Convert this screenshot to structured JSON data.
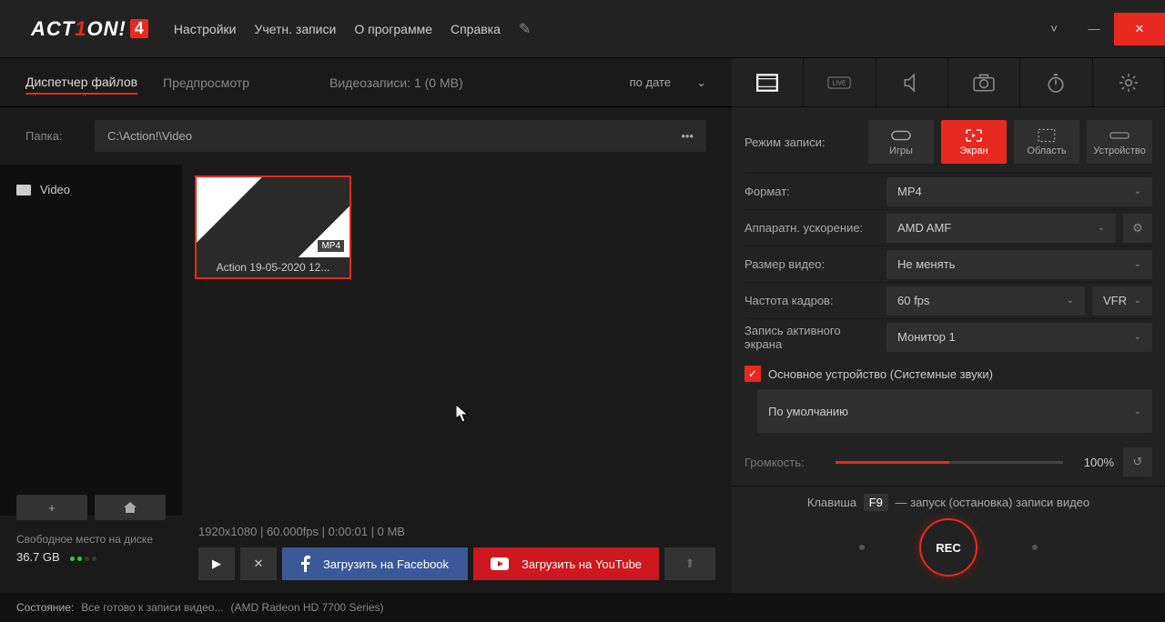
{
  "menu": {
    "settings": "Настройки",
    "accounts": "Учетн. записи",
    "about": "О программе",
    "help": "Справка"
  },
  "lefttabs": {
    "files": "Диспетчер файлов",
    "preview": "Предпросмотр",
    "count": "Видеозаписи: 1 (0 MB)",
    "sort": "по дате"
  },
  "folder": {
    "label": "Папка:",
    "path": "C:\\Action!\\Video"
  },
  "tree": {
    "video": "Video"
  },
  "thumb": {
    "name": "Action 19-05-2020 12...",
    "badge": "MP4"
  },
  "disk": {
    "label": "Свободное место на диске",
    "value": "36.7 GB"
  },
  "fileinfo": "1920x1080 | 60.000fps | 0:00:01 | 0 MB",
  "upload": {
    "fb": "Загрузить на Facebook",
    "yt": "Загрузить на YouTube"
  },
  "modes": {
    "label": "Режим записи:",
    "games": "Игры",
    "screen": "Экран",
    "region": "Область",
    "device": "Устройство"
  },
  "settingsp": {
    "format_l": "Формат:",
    "format_v": "MP4",
    "hw_l": "Аппаратн. ускорение:",
    "hw_v": "AMD AMF",
    "size_l": "Размер видео:",
    "size_v": "Не менять",
    "fps_l": "Частота кадров:",
    "fps_v": "60 fps",
    "fps_mode": "VFR",
    "mon_l": "Запись активного экрана",
    "mon_v": "Монитор 1",
    "audio_l": "Основное устройство (Системные звуки)",
    "audio_v": "По умолчанию",
    "vol_l": "Громкость:",
    "vol_v": "100%"
  },
  "rec": {
    "hint_pre": "Клавиша",
    "key": "F9",
    "hint_post": "— запуск (остановка) записи видео",
    "btn": "REC"
  },
  "status": {
    "label": "Состояние:",
    "text": "Все готово к записи видео...",
    "gpu": "(AMD Radeon HD 7700 Series)"
  }
}
